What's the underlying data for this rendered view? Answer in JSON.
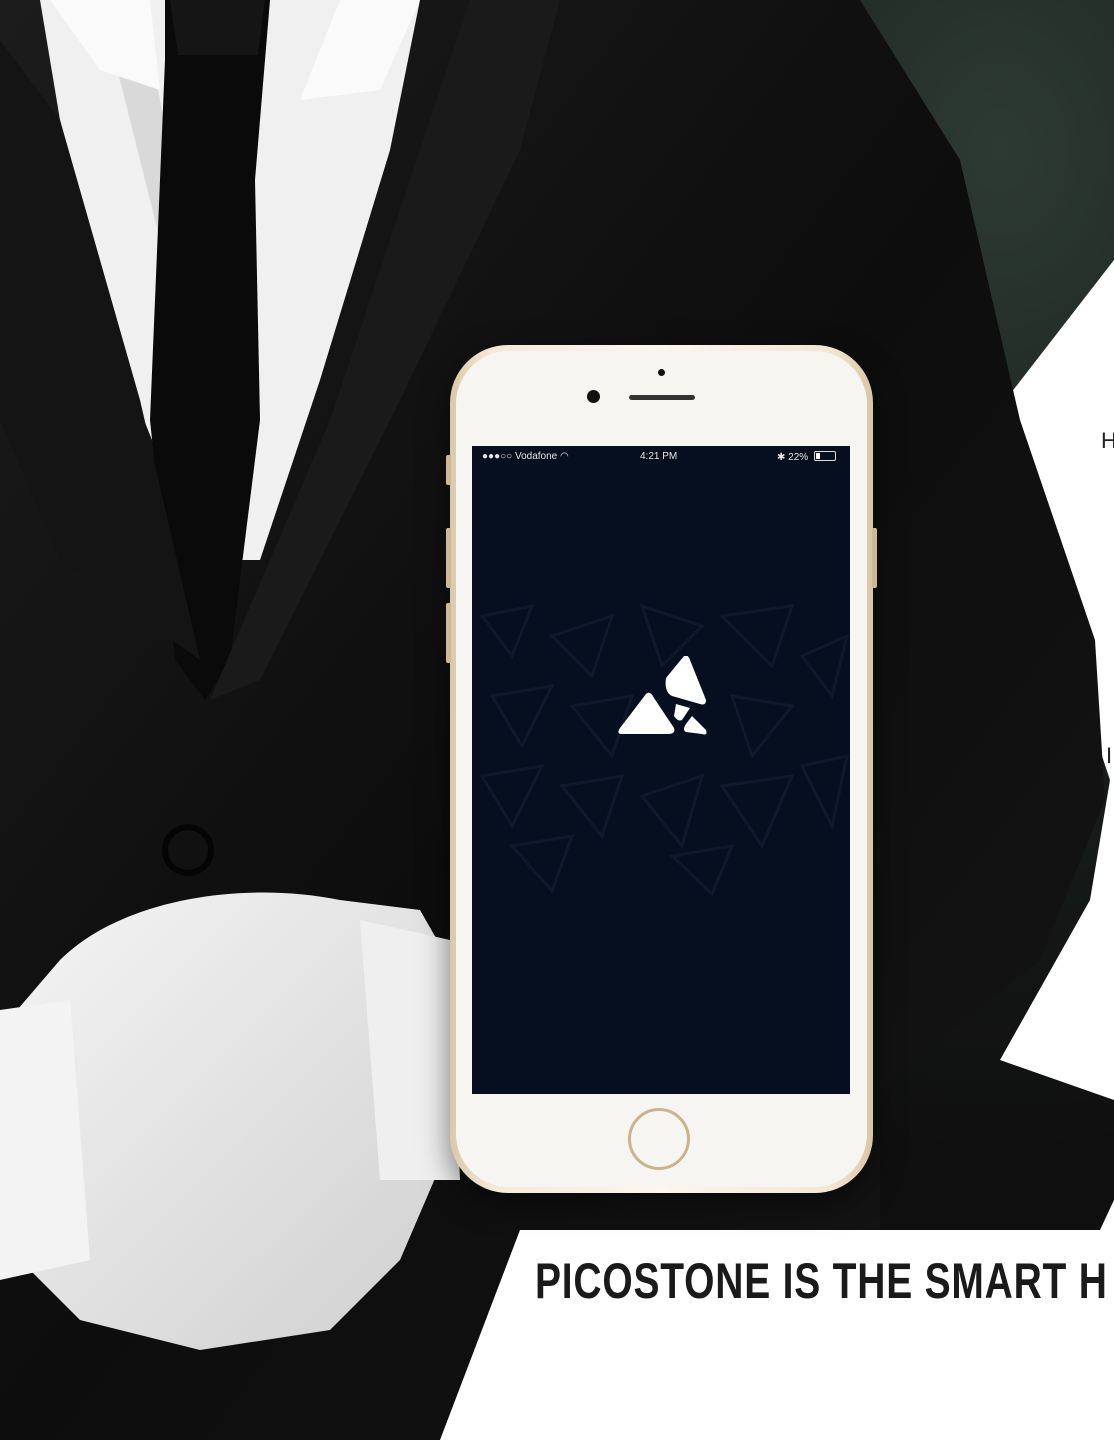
{
  "headline": "PICOSTONE IS THE SMART H",
  "right_fragments": {
    "top": "H",
    "middle": "I"
  },
  "phone": {
    "status_bar": {
      "carrier": "●●●○○ Vodafone",
      "wifi_icon": "wifi-icon",
      "time": "4:21 PM",
      "bluetooth_icon": "bluetooth-icon",
      "battery_percent": "22%",
      "battery_level": 0.22
    },
    "app_logo": "picostone-logo"
  },
  "colors": {
    "screen_background": "#060f20",
    "phone_frame": "#f4ead8",
    "suit": "#0c0c0c",
    "panel": "#ffffff"
  }
}
